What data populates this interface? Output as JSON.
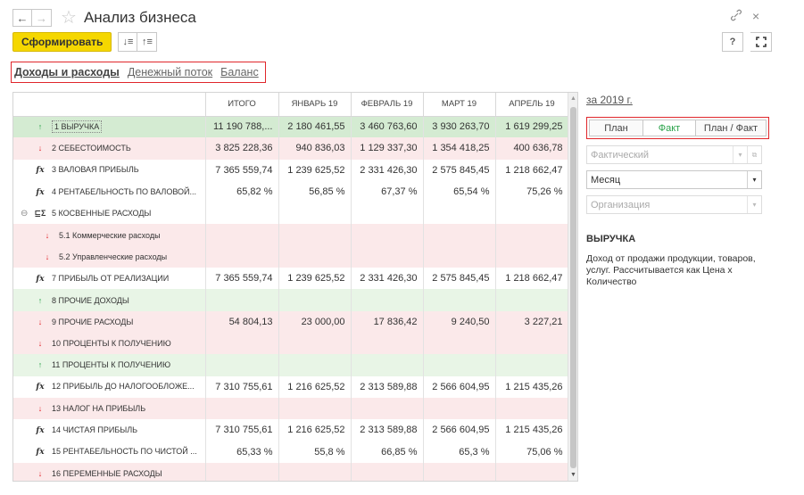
{
  "window": {
    "title": "Анализ бизнеса",
    "back_icon": "←",
    "forward_icon": "→",
    "star_icon": "☆",
    "link_icon": "🔗",
    "close_icon": "×"
  },
  "toolbar": {
    "generate_label": "Сформировать",
    "sort_asc_icon": "↓≡",
    "sort_desc_icon": "↑≡",
    "help_label": "?",
    "fullscreen_icon": "⛶"
  },
  "tabs": [
    {
      "label": "Доходы и расходы",
      "active": true
    },
    {
      "label": "Денежный поток",
      "active": false
    },
    {
      "label": "Баланс",
      "active": false
    }
  ],
  "table": {
    "columns": [
      "",
      "ИТОГО",
      "ЯНВАРЬ 19",
      "ФЕВРАЛЬ 19",
      "МАРТ 19",
      "АПРЕЛЬ 19"
    ],
    "rows": [
      {
        "icon": "↑",
        "type": "up",
        "style": "selected",
        "label": "1  ВЫРУЧКА",
        "values": [
          "11 190 788,...",
          "2 180 461,55",
          "3 460 763,60",
          "3 930 263,70",
          "1 619 299,25"
        ]
      },
      {
        "icon": "↓",
        "type": "down",
        "style": "red",
        "label": "2  СЕБЕСТОИМОСТЬ",
        "values": [
          "3 825 228,36",
          "940 836,03",
          "1 129 337,30",
          "1 354 418,25",
          "400 636,78"
        ]
      },
      {
        "icon": "fx",
        "type": "fx",
        "style": "white",
        "label": "3  ВАЛОВАЯ ПРИБЫЛЬ",
        "values": [
          "7 365 559,74",
          "1 239 625,52",
          "2 331 426,30",
          "2 575 845,45",
          "1 218 662,47"
        ]
      },
      {
        "icon": "fx",
        "type": "fx",
        "style": "white",
        "label": "4  РЕНТАБЕЛЬНОСТЬ ПО ВАЛОВОЙ...",
        "values": [
          "65,82 %",
          "56,85 %",
          "67,37 %",
          "65,54 %",
          "75,26 %"
        ]
      },
      {
        "icon": "⊑Σ",
        "type": "grp",
        "style": "white",
        "collapse": "⊖",
        "label": "5  КОСВЕННЫЕ РАСХОДЫ",
        "values": [
          "",
          "",
          "",
          "",
          ""
        ]
      },
      {
        "icon": "↓",
        "type": "down",
        "style": "red",
        "indent": true,
        "label": "5.1  Коммерческие расходы",
        "values": [
          "",
          "",
          "",
          "",
          ""
        ]
      },
      {
        "icon": "↓",
        "type": "down",
        "style": "red",
        "indent": true,
        "label": "5.2  Управленческие расходы",
        "values": [
          "",
          "",
          "",
          "",
          ""
        ]
      },
      {
        "icon": "fx",
        "type": "fx",
        "style": "white",
        "label": "7  ПРИБЫЛЬ ОТ РЕАЛИЗАЦИИ",
        "values": [
          "7 365 559,74",
          "1 239 625,52",
          "2 331 426,30",
          "2 575 845,45",
          "1 218 662,47"
        ]
      },
      {
        "icon": "↑",
        "type": "up",
        "style": "green",
        "label": "8  ПРОЧИЕ ДОХОДЫ",
        "values": [
          "",
          "",
          "",
          "",
          ""
        ]
      },
      {
        "icon": "↓",
        "type": "down",
        "style": "red",
        "label": "9  ПРОЧИЕ РАСХОДЫ",
        "values": [
          "54 804,13",
          "23 000,00",
          "17 836,42",
          "9 240,50",
          "3 227,21"
        ]
      },
      {
        "icon": "↓",
        "type": "down",
        "style": "red",
        "label": "10  ПРОЦЕНТЫ К ПОЛУЧЕНИЮ",
        "values": [
          "",
          "",
          "",
          "",
          ""
        ]
      },
      {
        "icon": "↑",
        "type": "up",
        "style": "green",
        "label": "11  ПРОЦЕНТЫ К ПОЛУЧЕНИЮ",
        "values": [
          "",
          "",
          "",
          "",
          ""
        ]
      },
      {
        "icon": "fx",
        "type": "fx",
        "style": "white",
        "label": "12  ПРИБЫЛЬ ДО НАЛОГООБЛОЖЕ...",
        "values": [
          "7 310 755,61",
          "1 216 625,52",
          "2 313 589,88",
          "2 566 604,95",
          "1 215 435,26"
        ]
      },
      {
        "icon": "↓",
        "type": "down",
        "style": "red",
        "label": "13  НАЛОГ НА ПРИБЫЛЬ",
        "values": [
          "",
          "",
          "",
          "",
          ""
        ]
      },
      {
        "icon": "fx",
        "type": "fx",
        "style": "white",
        "label": "14  ЧИСТАЯ ПРИБЫЛЬ",
        "values": [
          "7 310 755,61",
          "1 216 625,52",
          "2 313 589,88",
          "2 566 604,95",
          "1 215 435,26"
        ]
      },
      {
        "icon": "fx",
        "type": "fx",
        "style": "white",
        "label": "15  РЕНТАБЕЛЬНОСТЬ ПО ЧИСТОЙ ...",
        "values": [
          "65,33 %",
          "55,8 %",
          "66,85 %",
          "65,3 %",
          "75,06 %"
        ]
      },
      {
        "icon": "↓",
        "type": "down",
        "style": "red",
        "label": "16  ПЕРЕМЕННЫЕ РАСХОДЫ",
        "values": [
          "",
          "",
          "",
          "",
          ""
        ]
      }
    ]
  },
  "scrollbar": {
    "up_icon": "▲",
    "down_icon": "▼"
  },
  "panel": {
    "period_label": "за 2019 г.",
    "mode_buttons": [
      {
        "label": "План",
        "active": false
      },
      {
        "label": "Факт",
        "active": true
      },
      {
        "label": "План / Факт",
        "active": false
      }
    ],
    "scenario_placeholder": "Фактический",
    "period_type_value": "Месяц",
    "organization_placeholder": "Организация",
    "dropdown_icon": "▾",
    "open_icon": "⧉",
    "description_title": "ВЫРУЧКА",
    "description_text": "Доход от продажи продукции,  товаров, услуг. Рассчитывается как Цена х Количество"
  },
  "colors": {
    "accent_yellow": "#f5d700",
    "highlight_red": "#e0262b",
    "income_green": "#2aa24a",
    "row_green": "#e8f5e6",
    "row_red": "#fbe9ea"
  }
}
